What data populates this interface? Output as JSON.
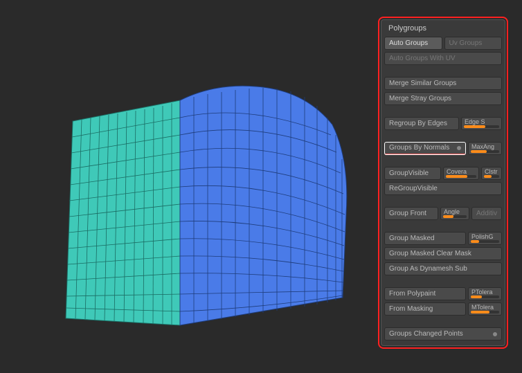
{
  "panel": {
    "title": "Polygroups",
    "auto_groups": "Auto Groups",
    "uv_groups": "Uv Groups",
    "auto_groups_uv": "Auto Groups With UV",
    "merge_similar": "Merge Similar Groups",
    "merge_stray": "Merge Stray Groups",
    "regroup_edges": "Regroup By Edges",
    "edge_s_label": "Edge S",
    "groups_by_normals": "Groups By Normals",
    "maxang_label": "MaxAng",
    "group_visible": "GroupVisible",
    "coverage_label": "Covera",
    "clstr_label": "Clstr",
    "regroup_visible": "ReGroupVisible",
    "group_front": "Group Front",
    "angle_label": "Angle",
    "additive_label": "Additiv",
    "group_masked": "Group Masked",
    "polishg_label": "PolishG",
    "group_masked_clear": "Group Masked Clear Mask",
    "group_dynamesh": "Group As Dynamesh Sub",
    "from_polypaint": "From Polypaint",
    "ptolera_label": "PTolera",
    "from_masking": "From Masking",
    "mtolera_label": "MTolera",
    "groups_changed": "Groups Changed Points"
  },
  "chart_data": {
    "type": "other",
    "note": "3D viewport showing a rounded cube mesh with visible wireframe polygroups. Front/top curved face colored blue; left side face colored teal."
  }
}
